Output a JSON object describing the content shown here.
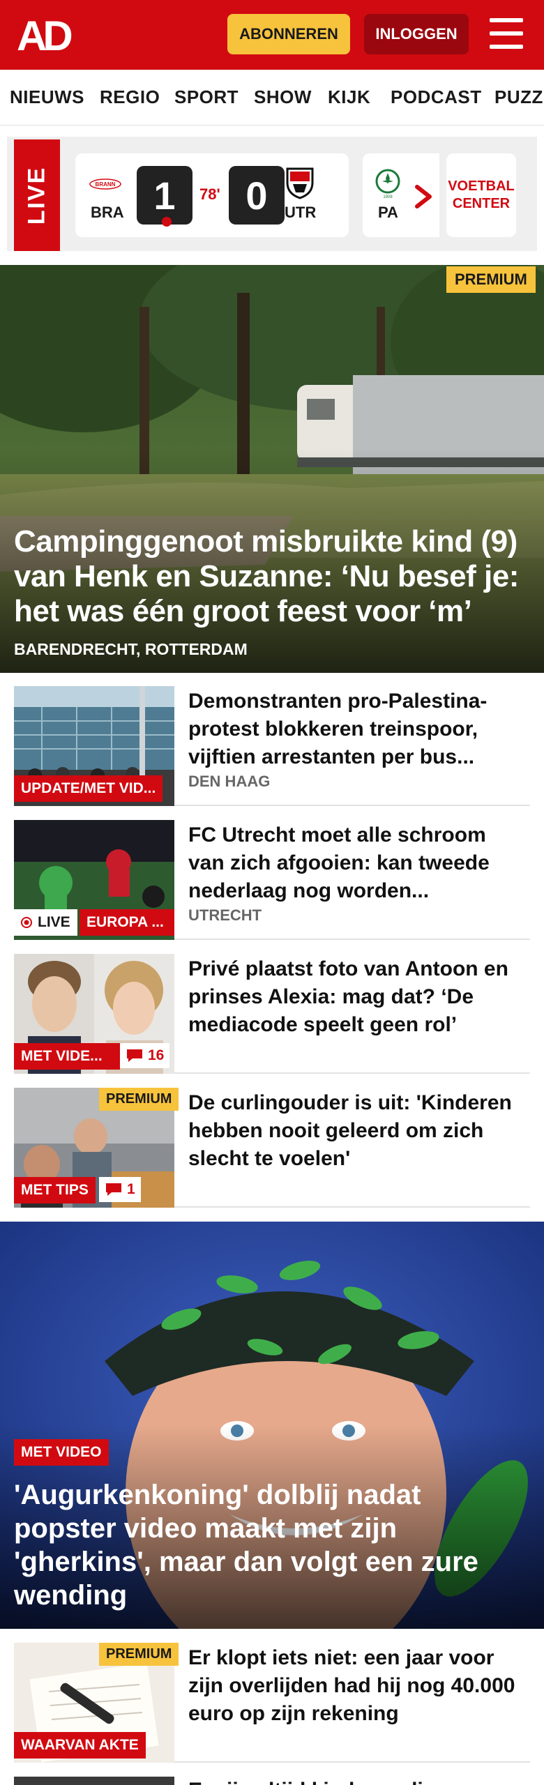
{
  "header": {
    "logo": "AD",
    "subscribe_label": "ABONNEREN",
    "login_label": "INLOGGEN",
    "brand_color": "#d10a11",
    "menu_icon": "hamburger-icon"
  },
  "nav": {
    "items": [
      "NIEUWS",
      "REGIO",
      "SPORT",
      "SHOW",
      "KIJK",
      "PODCAST",
      "PUZZ"
    ]
  },
  "live": {
    "label": "LIVE",
    "match": {
      "home_badge": "BRANN",
      "home": "BRA",
      "home_score": "1",
      "minute": "78'",
      "away_score": "0",
      "away": "UTR"
    },
    "next_match": {
      "home": "PA"
    },
    "voetbal_center": "VOETBAL CENTER"
  },
  "hero": {
    "badge": "PREMIUM",
    "title": "Campinggenoot misbruikte kind (9) van Henk en Suzanne: ‘Nu besef je: het was één groot feest voor ‘m’",
    "location": "BARENDRECHT, ROTTERDAM"
  },
  "articles": [
    {
      "title": "Demonstranten pro-Palestina-protest blokkeren treinspoor, vijftien arrestanten per bus...",
      "location": "DEN HAAG",
      "tag": "UPDATE/MET VID..."
    },
    {
      "title": "FC Utrecht moet alle schroom van zich afgooien: kan tweede nederlaag nog worden...",
      "location": "UTRECHT",
      "live_tag": "LIVE",
      "tag": "EUROPA ..."
    },
    {
      "title": "Privé plaatst foto van Antoon en prinses Alexia: mag dat? ‘De mediacode speelt geen rol’",
      "tag": "MET VIDE...",
      "comments": "16"
    },
    {
      "title": "De curlingouder is uit: 'Kinderen hebben nooit geleerd om zich slecht te voelen'",
      "badge": "PREMIUM",
      "tag": "MET TIPS",
      "comments": "1"
    }
  ],
  "feature": {
    "tag": "MET VIDEO",
    "title": "'Augurkenkoning' dolblij nadat popster video maakt met zijn 'gherkins', maar dan volgt een zure wending"
  },
  "article_after": {
    "title": "Er klopt iets niet: een jaar voor zijn overlijden had hij nog 40.000 euro op zijn rekening",
    "badge": "PREMIUM",
    "tag": "WAARVAN AKTE"
  },
  "next_article_partial": {
    "title": "Er zijn altijd kinderen die..."
  }
}
